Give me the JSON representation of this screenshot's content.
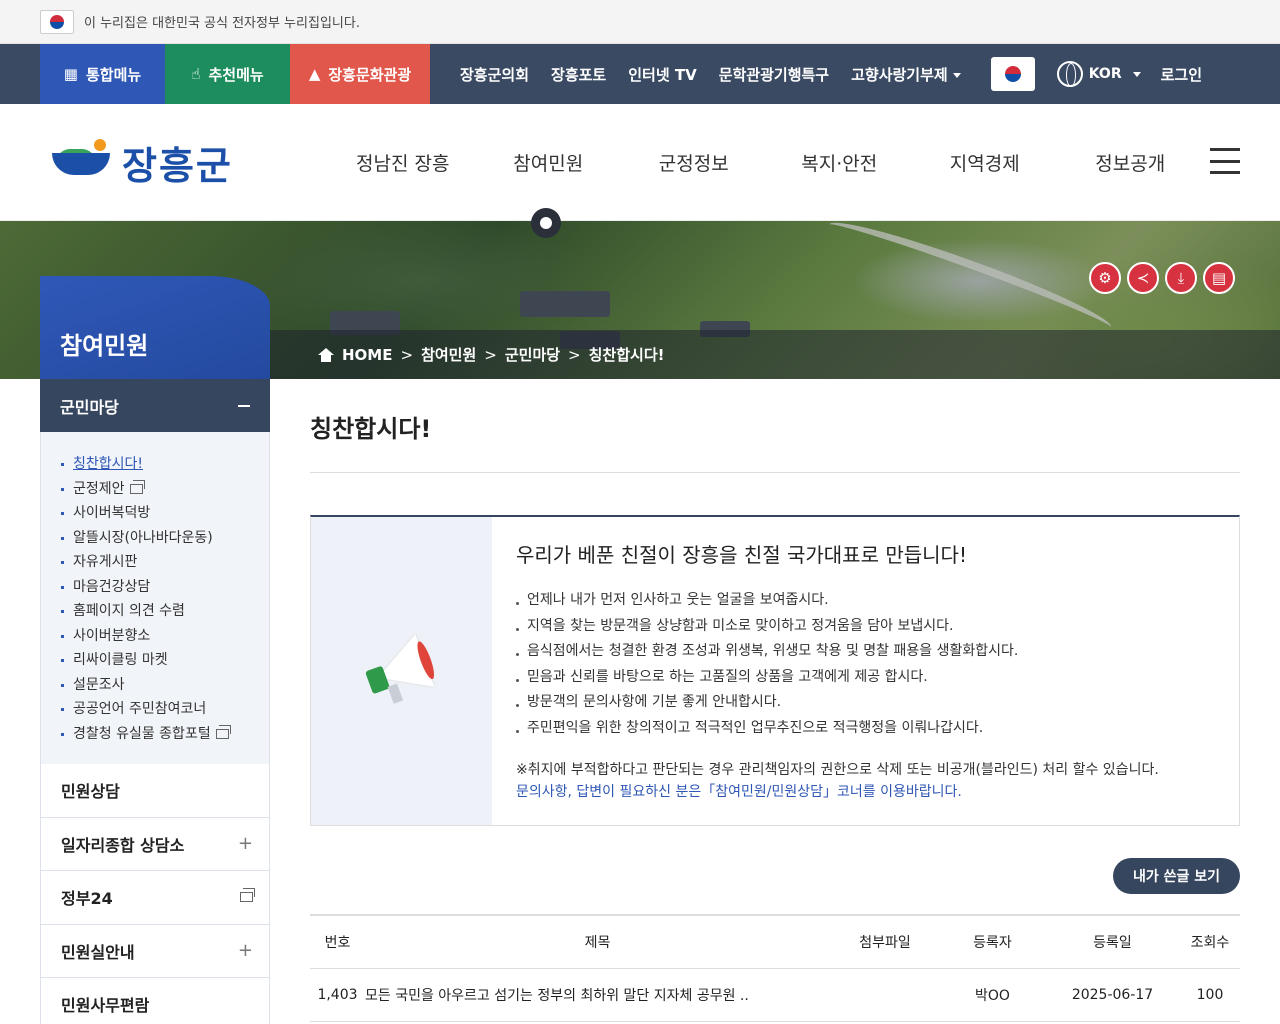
{
  "gov_banner": {
    "text": "이 누리집은 대한민국 공식 전자정부 누리집입니다."
  },
  "topbar": {
    "quick": [
      "통합메뉴",
      "추천메뉴",
      "장흥문화관광"
    ],
    "links": [
      "장흥군의회",
      "장흥포토",
      "인터넷 TV",
      "문학관광기행특구",
      "고향사랑기부제"
    ],
    "lang": "KOR",
    "login": "로그인"
  },
  "header": {
    "logo": "장흥군",
    "nav": [
      "정남진 장흥",
      "참여민원",
      "군정정보",
      "복지·안전",
      "지역경제",
      "정보공개"
    ]
  },
  "breadcrumb": [
    "HOME",
    "참여민원",
    "군민마당",
    "칭찬합시다!"
  ],
  "sidebar": {
    "title": "참여민원",
    "section": "군민마당",
    "sub_items": [
      "칭찬합시다!",
      "군정제안",
      "사이버복덕방",
      "알뜰시장(아나바다운동)",
      "자유게시판",
      "마음건강상담",
      "홈페이지 의견 수렴",
      "사이버분향소",
      "리싸이클링 마켓",
      "설문조사",
      "공공언어 주민참여코너",
      "경찰청 유실물 종합포털"
    ],
    "items": [
      "민원상담",
      "일자리종합 상담소",
      "정부24",
      "민원실안내",
      "민원사무편람"
    ]
  },
  "page": {
    "title": "칭찬합시다!",
    "notice_heading": "우리가 베푼 친절이 장흥을 친절 국가대표로 만듭니다!",
    "notice_items": [
      "언제나 내가 먼저 인사하고 웃는 얼굴을 보여줍시다.",
      "지역을 찾는 방문객을 상냥함과 미소로 맞이하고 정겨움을 담아 보냅시다.",
      "음식점에서는 청결한 환경 조성과 위생복, 위생모 착용 및 명찰 패용을 생활화합시다.",
      "믿음과 신뢰를 바탕으로 하는 고품질의 상품을 고객에게 제공 합시다.",
      "방문객의 문의사항에 기분 좋게 안내합시다.",
      "주민편익을 위한 창의적이고 적극적인 업무추진으로 적극행정을 이뤄나갑시다."
    ],
    "warning": "※취지에 부적합하다고 판단되는 경우 관리책임자의 권한으로 삭제 또는 비공개(블라인드) 처리 할수 있습니다.",
    "info": "문의사항, 답변이 필요하신 분은「참여민원/민원상담」코너를 이용바랍니다.",
    "my_posts_button": "내가 쓴글 보기"
  },
  "table": {
    "headers": [
      "번호",
      "제목",
      "첨부파일",
      "등록자",
      "등록일",
      "조회수"
    ],
    "rows": [
      {
        "no": "1,403",
        "title": "모든 국민을 아우르고 섬기는 정부의 최하위 말단 지자체 공무원 ..",
        "file": "",
        "author": "박OO",
        "date": "2025-06-17",
        "views": "100"
      }
    ]
  }
}
